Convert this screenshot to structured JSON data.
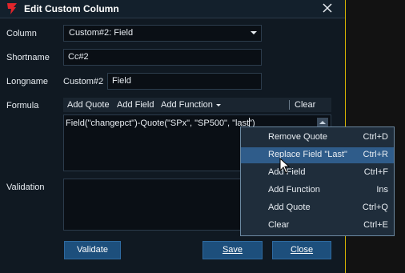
{
  "window": {
    "title": "Edit Custom Column"
  },
  "labels": {
    "column": "Column",
    "shortname": "Shortname",
    "longname": "Longname",
    "formula": "Formula",
    "validation": "Validation"
  },
  "fields": {
    "column_value": "Custom#2: Field",
    "shortname_value": "Cc#2",
    "longname_prefix": "Custom#2",
    "longname_value": "Field",
    "formula_text": "Field(\"changepct\")-Quote(\"SPx\", \"SP500\", \"last\")",
    "validation_text": ""
  },
  "toolbar": {
    "add_quote": "Add Quote",
    "add_field": "Add Field",
    "add_function": "Add Function",
    "clear": "Clear"
  },
  "context_menu": {
    "items": [
      {
        "label": "Remove Quote",
        "shortcut": "Ctrl+D"
      },
      {
        "label": "Replace Field \"Last\"",
        "shortcut": "Ctrl+R"
      },
      {
        "label": "Add Field",
        "shortcut": "Ctrl+F"
      },
      {
        "label": "Add Function",
        "shortcut": "Ins"
      },
      {
        "label": "Add Quote",
        "shortcut": "Ctrl+Q"
      },
      {
        "label": "Clear",
        "shortcut": "Ctrl+E"
      }
    ],
    "highlighted_index": 1
  },
  "buttons": {
    "validate": "Validate",
    "save": "Save",
    "close": "Close"
  },
  "colors": {
    "accent": "#d9b400",
    "button": "#1d4f7c",
    "highlight": "#2f5c8a",
    "logo": "#e0252b"
  },
  "icons": {
    "app": "app-logo-icon",
    "close": "close-icon",
    "scroll": "scroll-up-icon",
    "cursor": "mouse-pointer-icon"
  }
}
